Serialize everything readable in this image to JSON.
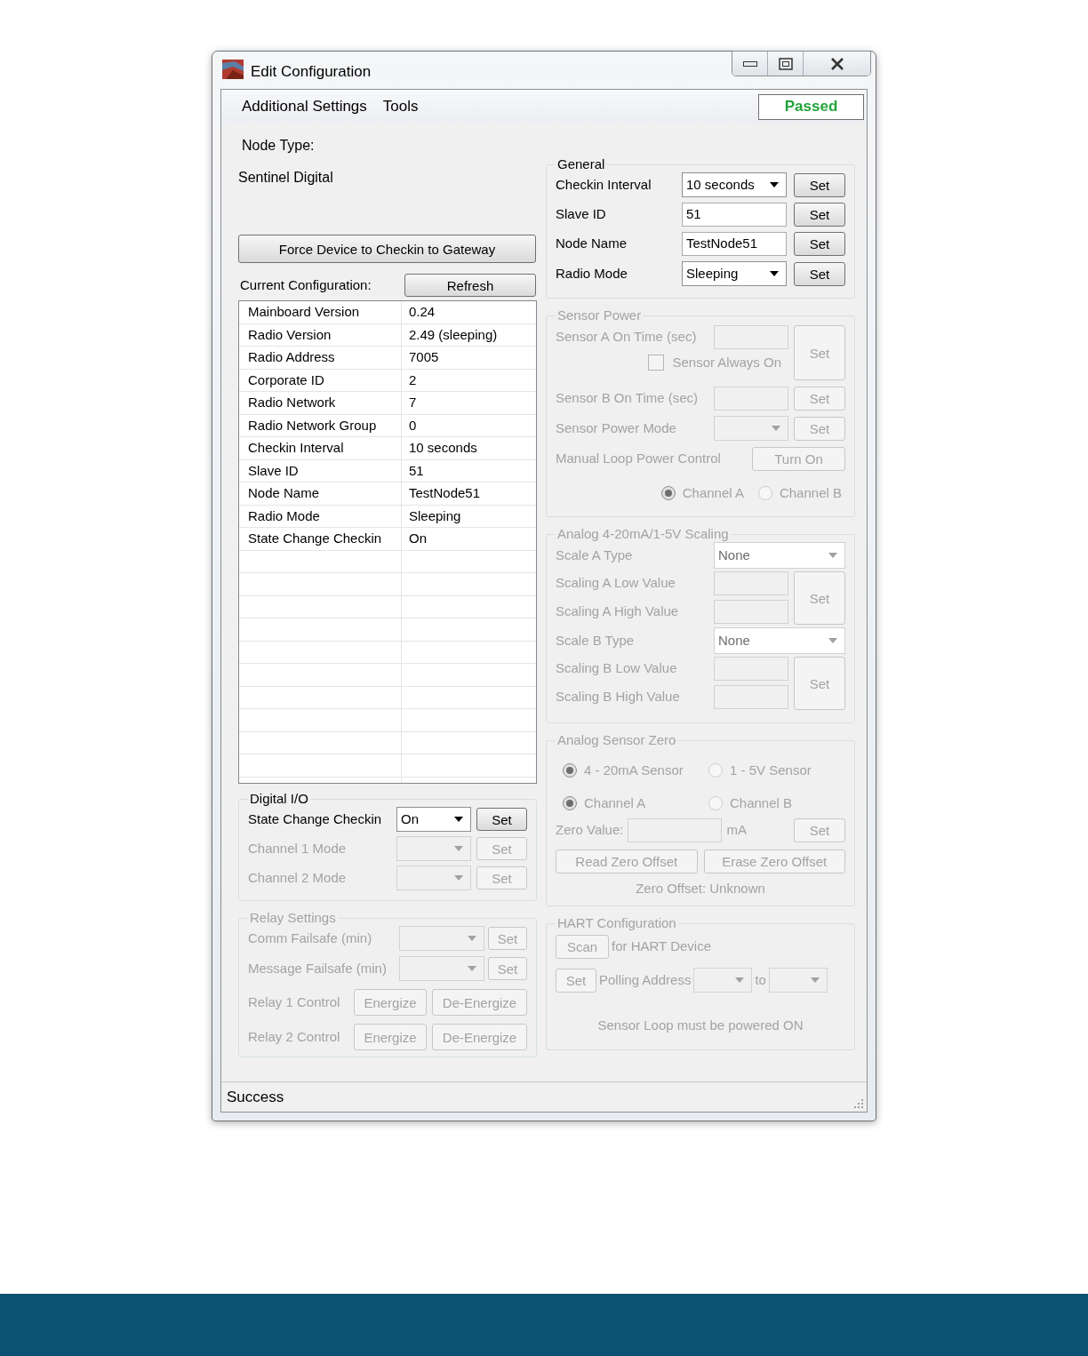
{
  "window": {
    "title": "Edit Configuration"
  },
  "menu": [
    {
      "label": "Additional Settings"
    },
    {
      "label": "Tools"
    }
  ],
  "status_badge": "Passed",
  "node_type": {
    "label": "Node Type:",
    "value": "Sentinel Digital"
  },
  "force_button": "Force Device to Checkin to Gateway",
  "current_configuration": {
    "label": "Current Configuration:",
    "refresh_button": "Refresh",
    "rows": [
      {
        "label": "Mainboard Version",
        "value": "0.24"
      },
      {
        "label": "Radio Version",
        "value": "2.49 (sleeping)"
      },
      {
        "label": "Radio Address",
        "value": "7005"
      },
      {
        "label": "Corporate ID",
        "value": "2"
      },
      {
        "label": "Radio Network",
        "value": "7"
      },
      {
        "label": "Radio Network Group",
        "value": "0"
      },
      {
        "label": "Checkin Interval",
        "value": "10 seconds"
      },
      {
        "label": "Slave ID",
        "value": "51"
      },
      {
        "label": "Node Name",
        "value": "TestNode51"
      },
      {
        "label": "Radio Mode",
        "value": "Sleeping"
      },
      {
        "label": "State Change Checkin",
        "value": "On"
      }
    ]
  },
  "digital_io": {
    "title": "Digital I/O",
    "rows": [
      {
        "label": "State Change Checkin",
        "value": "On",
        "button": "Set",
        "disabled": false
      },
      {
        "label": "Channel 1 Mode",
        "button": "Set",
        "disabled": true
      },
      {
        "label": "Channel 2 Mode",
        "button": "Set",
        "disabled": true
      }
    ]
  },
  "relay_settings": {
    "title": "Relay Settings",
    "disabled": true,
    "failsafes": [
      {
        "label": "Comm Failsafe (min)",
        "button": "Set"
      },
      {
        "label": "Message Failsafe (min)",
        "button": "Set"
      }
    ],
    "relays": [
      {
        "label": "Relay 1 Control",
        "buttons": [
          "Energize",
          "De-Energize"
        ]
      },
      {
        "label": "Relay 2 Control",
        "buttons": [
          "Energize",
          "De-Energize"
        ]
      }
    ]
  },
  "general": {
    "title": "General",
    "disabled": false,
    "rows": [
      {
        "kind": "select",
        "label": "Checkin Interval",
        "value": "10 seconds",
        "button": "Set"
      },
      {
        "kind": "input",
        "label": "Slave ID",
        "value": "51",
        "button": "Set"
      },
      {
        "kind": "input",
        "label": "Node Name",
        "value": "TestNode51",
        "button": "Set"
      },
      {
        "kind": "select",
        "label": "Radio Mode",
        "value": "Sleeping",
        "button": "Set"
      }
    ]
  },
  "sensor_power": {
    "title": "Sensor Power",
    "disabled": true,
    "sensor_a": {
      "label": "Sensor A On Time (sec)",
      "button": "Set"
    },
    "always_on": {
      "label": "Sensor Always On",
      "checked": false
    },
    "sensor_b": {
      "label": "Sensor B On Time (sec)",
      "button": "Set"
    },
    "power_mode": {
      "label": "Sensor Power Mode",
      "button": "Set"
    },
    "manual_loop": {
      "label": "Manual Loop Power Control",
      "button": "Turn On"
    },
    "channels": [
      {
        "label": "Channel A",
        "selected": true
      },
      {
        "label": "Channel B",
        "selected": false
      }
    ]
  },
  "analog_scaling": {
    "title": "Analog 4-20mA/1-5V Scaling",
    "disabled": true,
    "scales": [
      {
        "type_label": "Scale A Type",
        "type_value": "None",
        "low_label": "Scaling A Low Value",
        "high_label": "Scaling A High Value",
        "button": "Set"
      },
      {
        "type_label": "Scale B Type",
        "type_value": "None",
        "low_label": "Scaling B Low Value",
        "high_label": "Scaling B High Value",
        "button": "Set"
      }
    ]
  },
  "analog_zero": {
    "title": "Analog Sensor Zero",
    "disabled": true,
    "sensor_types": [
      {
        "label": "4 - 20mA Sensor",
        "selected": true
      },
      {
        "label": "1 - 5V Sensor",
        "selected": false
      }
    ],
    "channels": [
      {
        "label": "Channel A",
        "selected": true
      },
      {
        "label": "Channel B",
        "selected": false
      }
    ],
    "zero_value": {
      "label": "Zero Value:",
      "unit": "mA",
      "button": "Set"
    },
    "buttons": [
      "Read Zero Offset",
      "Erase Zero Offset"
    ],
    "offset_text": "Zero Offset: Unknown"
  },
  "hart": {
    "title": "HART Configuration",
    "disabled": true,
    "scan_button": "Scan",
    "scan_text": "for HART Device",
    "set_button": "Set",
    "polling_label": "Polling Address",
    "to_label": "to",
    "note": "Sensor Loop must be powered ON"
  },
  "status_bar": "Success"
}
